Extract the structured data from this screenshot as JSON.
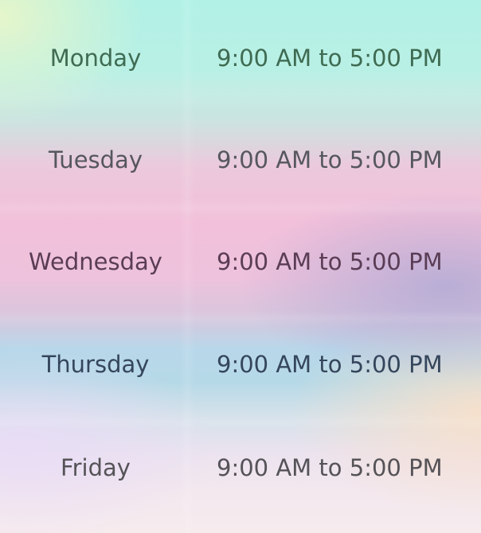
{
  "business_hours": [
    {
      "day": "Monday",
      "hours": "9:00 AM to 5:00 PM"
    },
    {
      "day": "Tuesday",
      "hours": "9:00 AM to 5:00 PM"
    },
    {
      "day": "Wednesday",
      "hours": "9:00 AM to 5:00 PM"
    },
    {
      "day": "Thursday",
      "hours": "9:00 AM to 5:00 PM"
    },
    {
      "day": "Friday",
      "hours": "9:00 AM to 5:00 PM"
    }
  ]
}
